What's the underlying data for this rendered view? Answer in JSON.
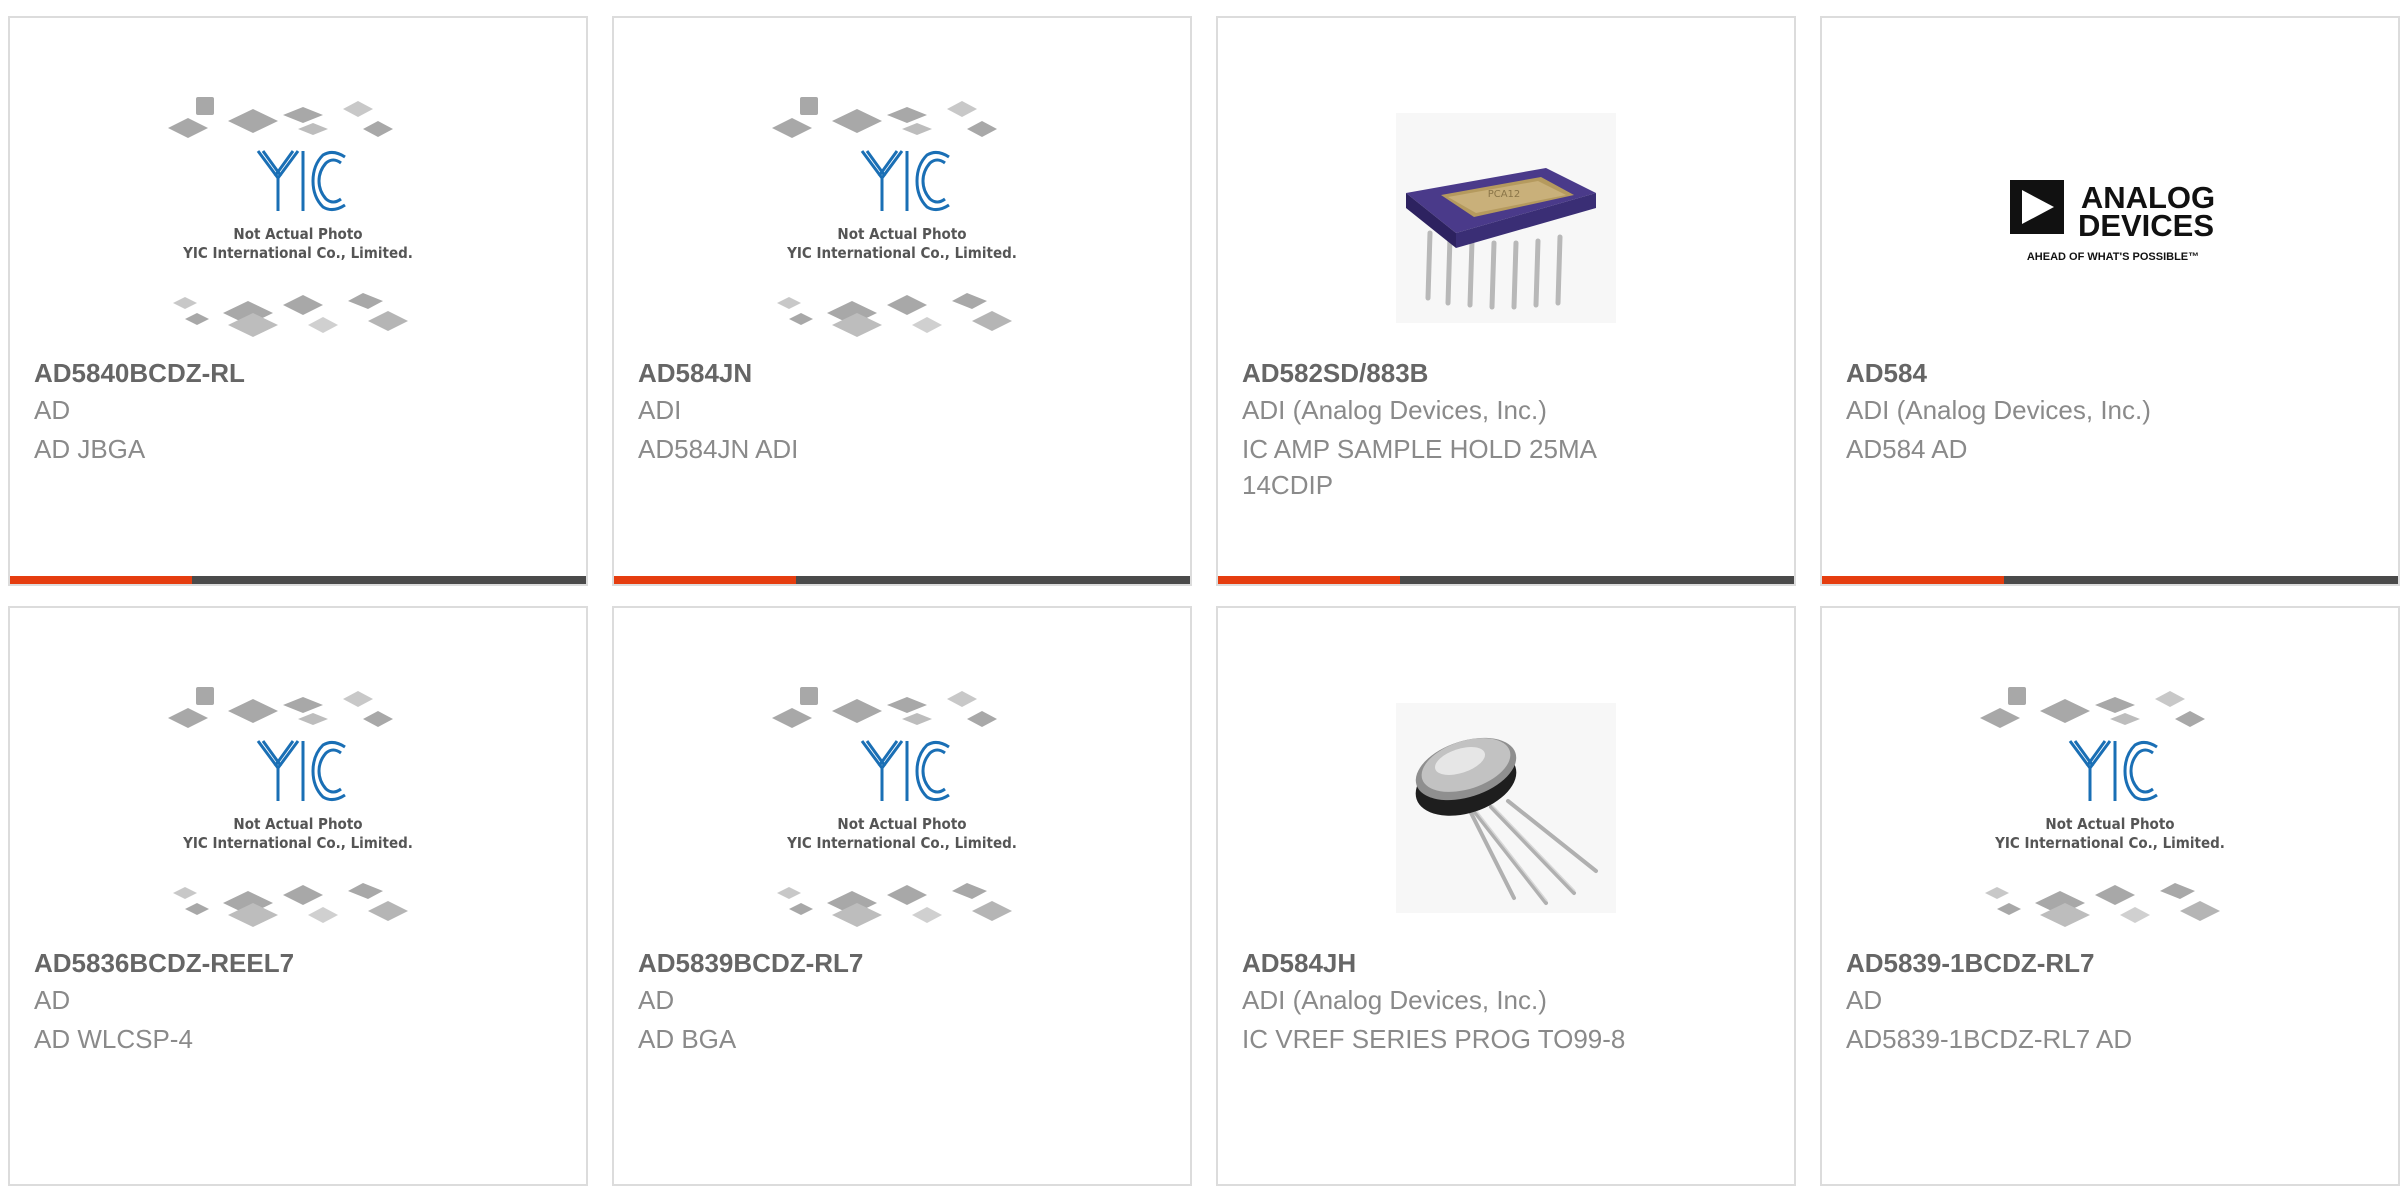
{
  "products": [
    {
      "part_number": "AD5840BCDZ-RL",
      "manufacturer": "AD",
      "description": "AD JBGA",
      "image": "placeholder-packages",
      "placeholder": {
        "logo": "YIC",
        "line1": "Not Actual Photo",
        "line2": "YIC International Co., Limited."
      }
    },
    {
      "part_number": "AD584JN",
      "manufacturer": "ADI",
      "description": "AD584JN ADI",
      "image": "placeholder-packages",
      "placeholder": {
        "logo": "YIC",
        "line1": "Not Actual Photo",
        "line2": "YIC International Co., Limited."
      }
    },
    {
      "part_number": "AD582SD/883B",
      "manufacturer": "ADI (Analog Devices, Inc.)",
      "description": "IC AMP SAMPLE HOLD 25MA 14CDIP",
      "image": "ceramic-dip-14-chip"
    },
    {
      "part_number": "AD584",
      "manufacturer": "ADI (Analog Devices, Inc.)",
      "description": "AD584 AD",
      "image": "analog-devices-logo",
      "logo": {
        "line1": "ANALOG",
        "line2": "DEVICES",
        "tagline": "AHEAD OF WHAT'S POSSIBLE™"
      }
    },
    {
      "part_number": "AD5836BCDZ-REEL7",
      "manufacturer": "AD",
      "description": "AD WLCSP-4",
      "image": "placeholder-packages",
      "placeholder": {
        "logo": "YIC",
        "line1": "Not Actual Photo",
        "line2": "YIC International Co., Limited."
      }
    },
    {
      "part_number": "AD5839BCDZ-RL7",
      "manufacturer": "AD",
      "description": "AD BGA",
      "image": "placeholder-packages",
      "placeholder": {
        "logo": "YIC",
        "line1": "Not Actual Photo",
        "line2": "YIC International Co., Limited."
      }
    },
    {
      "part_number": "AD584JH",
      "manufacturer": "ADI (Analog Devices, Inc.)",
      "description": "IC VREF SERIES PROG TO99-8",
      "image": "to99-metal-can-chip"
    },
    {
      "part_number": "AD5839-1BCDZ-RL7",
      "manufacturer": "AD",
      "description": "AD5839-1BCDZ-RL7 AD",
      "image": "placeholder-packages",
      "placeholder": {
        "logo": "YIC",
        "line1": "Not Actual Photo",
        "line2": "YIC International Co., Limited."
      }
    }
  ],
  "colors": {
    "accent": "#e53d0f",
    "bar": "#4a4a4a",
    "border": "#dcdcdc",
    "title_text": "#666666",
    "body_text": "#8a8a8a",
    "yic_blue": "#1a6fb5"
  }
}
